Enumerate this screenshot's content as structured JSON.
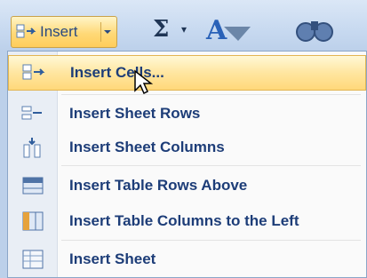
{
  "ribbon": {
    "insert_button_label": "Insert",
    "sigma_label": "Σ",
    "sigma_drop": "▾",
    "font_letter": "A"
  },
  "menu": {
    "items": [
      {
        "label": "Insert Cells...",
        "icon": "insert-cells-icon",
        "highlighted": true
      },
      {
        "label": "Insert Sheet Rows",
        "icon": "insert-rows-icon"
      },
      {
        "label": "Insert Sheet Columns",
        "icon": "insert-columns-icon"
      },
      {
        "label": "Insert Table Rows Above",
        "icon": "insert-table-rows-icon"
      },
      {
        "label": "Insert Table Columns to the Left",
        "icon": "insert-table-columns-icon"
      },
      {
        "label": "Insert Sheet",
        "icon": "insert-sheet-icon"
      }
    ]
  },
  "colors": {
    "highlight": "#ffe6a0",
    "menu_text": "#1d3d78",
    "ribbon_bg": "#c7d9f0"
  }
}
